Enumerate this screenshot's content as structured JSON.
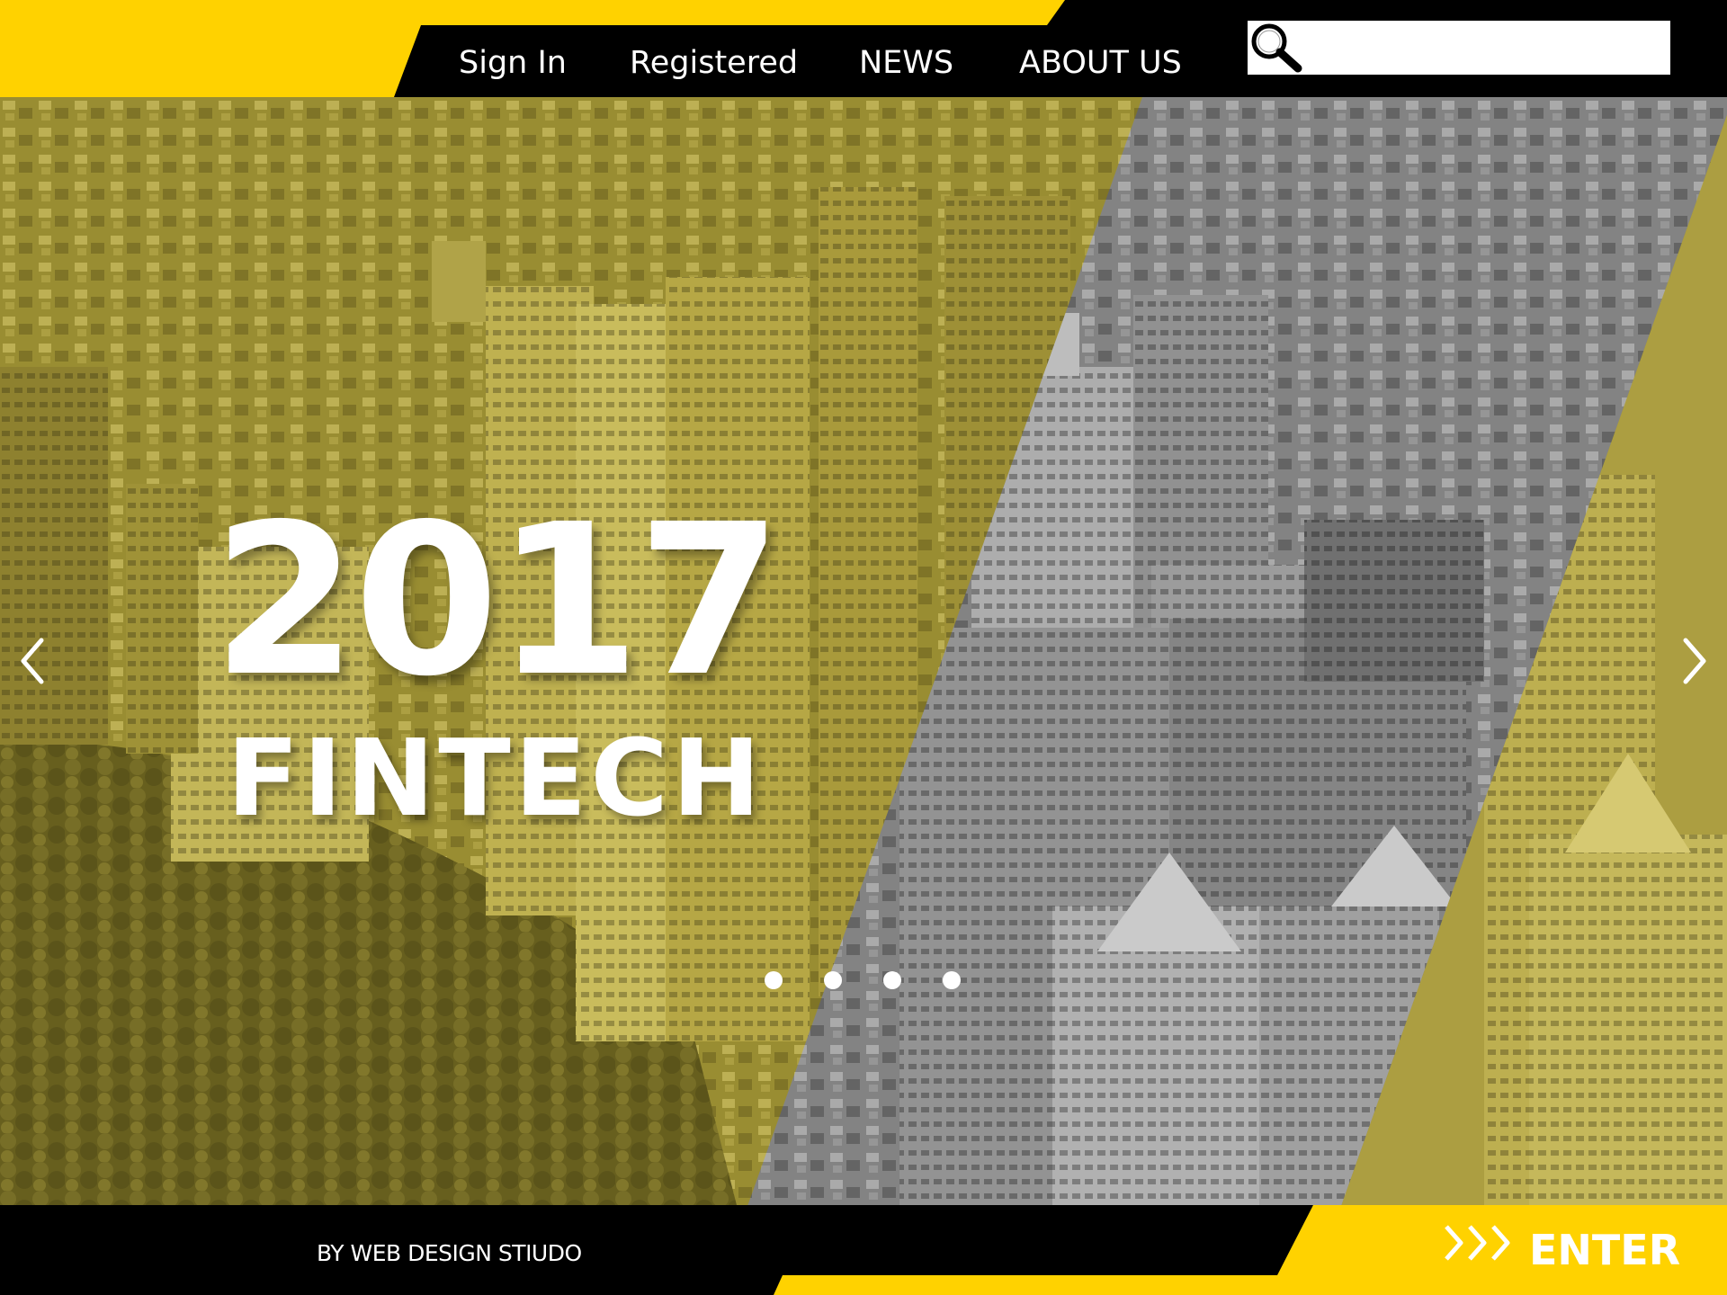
{
  "nav": {
    "items": [
      {
        "label": "Sign In"
      },
      {
        "label": "Registered"
      },
      {
        "label": "NEWS"
      },
      {
        "label": "ABOUT US"
      }
    ]
  },
  "search": {
    "placeholder": "",
    "value": "",
    "icon": "search-icon"
  },
  "hero": {
    "year": "2017",
    "subtitle": "FINTECH",
    "prev_icon": "chevron-left-icon",
    "next_icon": "chevron-right-icon",
    "slide_count": 4
  },
  "footer": {
    "credit": "BY WEB DESIGN STIUDO",
    "enter_label": "ENTER",
    "enter_icon": "triple-chevron-right-icon"
  },
  "colors": {
    "brand_yellow": "#FFD200",
    "black": "#000000",
    "white": "#FFFFFF",
    "photo_tint": "#B5A640",
    "photo_gray": "#7A7A7A"
  }
}
